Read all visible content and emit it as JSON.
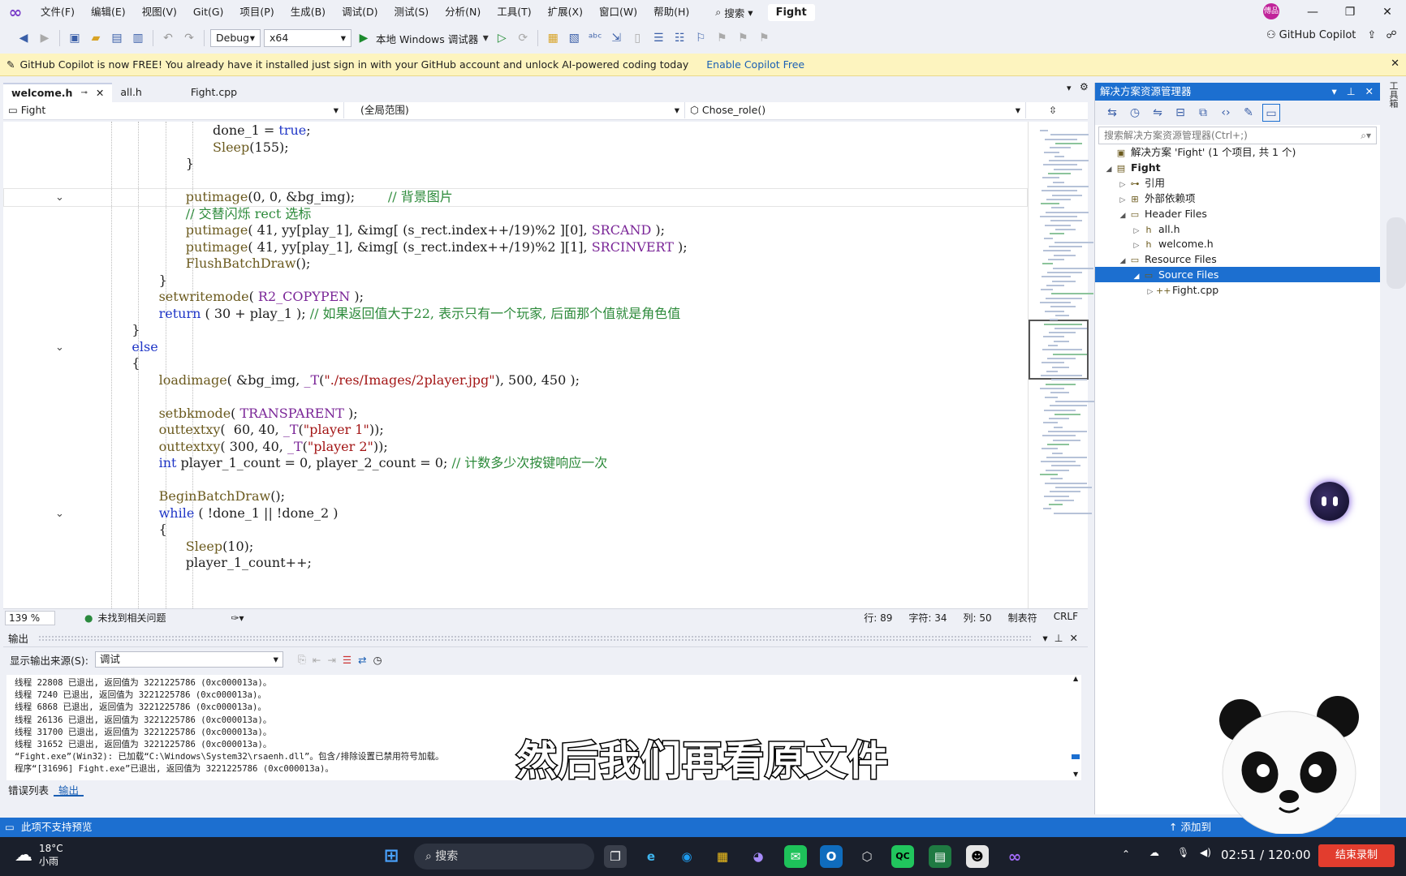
{
  "menu": [
    "文件(F)",
    "编辑(E)",
    "视图(V)",
    "Git(G)",
    "项目(P)",
    "生成(B)",
    "调试(D)",
    "测试(S)",
    "分析(N)",
    "工具(T)",
    "扩展(X)",
    "窗口(W)",
    "帮助(H)"
  ],
  "search_label": "搜索",
  "project_name": "Fight",
  "avatar_text": "傅品",
  "toolbar": {
    "config": "Debug",
    "platform": "x64",
    "run_label": "本地 Windows 调试器",
    "copilot_label": "GitHub Copilot"
  },
  "infobar": {
    "message": "GitHub Copilot is now FREE! You already have it installed just sign in with your GitHub account and unlock AI-powered coding today",
    "link": "Enable Copilot Free"
  },
  "tabs": [
    {
      "label": "welcome.h"
    },
    {
      "label": "all.h"
    },
    {
      "label": "Fight.cpp"
    }
  ],
  "navbar": {
    "project": "Fight",
    "scope": "(全局范围)",
    "member": "Chose_role()"
  },
  "code_lines": [
    {
      "indent": 10,
      "html": "done_1 = <span class=\"kw\">true</span>;"
    },
    {
      "indent": 10,
      "html": "<span class=\"fn\">Sleep</span>(155);"
    },
    {
      "indent": 8,
      "html": "}"
    },
    {
      "indent": 0,
      "html": ""
    },
    {
      "indent": 8,
      "fold": true,
      "current": true,
      "html": "<span class=\"fn\">putimage</span>(0, 0, &amp;bg_img);        <span class=\"cm\">// 背景图片</span>"
    },
    {
      "indent": 8,
      "html": "<span class=\"cm\">// 交替闪烁 rect 选标</span>"
    },
    {
      "indent": 8,
      "html": "<span class=\"fn\">putimage</span>( 41, yy[play_1], &amp;img[ (s_rect.index++/19)%2 ][0], <span class=\"mc\">SRCAND</span> );"
    },
    {
      "indent": 8,
      "html": "<span class=\"fn\">putimage</span>( 41, yy[play_1], &amp;img[ (s_rect.index++/19)%2 ][1], <span class=\"mc\">SRCINVERT</span> );"
    },
    {
      "indent": 8,
      "html": "<span class=\"fn\">FlushBatchDraw</span>();"
    },
    {
      "indent": 6,
      "html": "}"
    },
    {
      "indent": 6,
      "html": "<span class=\"fn\">setwritemode</span>( <span class=\"mc\">R2_COPYPEN</span> );"
    },
    {
      "indent": 6,
      "html": "<span class=\"kw\">return</span> ( 30 + play_1 ); <span class=\"cm\">// 如果返回值大于22, 表示只有一个玩家, 后面那个值就是角色值</span>"
    },
    {
      "indent": 4,
      "html": "}"
    },
    {
      "indent": 4,
      "fold": true,
      "html": "<span class=\"kw\">else</span>"
    },
    {
      "indent": 4,
      "html": "{"
    },
    {
      "indent": 6,
      "html": "<span class=\"fn\">loadimage</span>( &amp;bg_img, <span class=\"mc\">_T</span>(<span class=\"st\">\"./res/Images/2player.jpg\"</span>), 500, 450 );"
    },
    {
      "indent": 0,
      "html": ""
    },
    {
      "indent": 6,
      "html": "<span class=\"fn\">setbkmode</span>( <span class=\"mc\">TRANSPARENT</span> );"
    },
    {
      "indent": 6,
      "html": "<span class=\"fn\">outtextxy</span>(  60, 40, <span class=\"mc\">_T</span>(<span class=\"st\">\"player 1\"</span>));"
    },
    {
      "indent": 6,
      "html": "<span class=\"fn\">outtextxy</span>( 300, 40, <span class=\"mc\">_T</span>(<span class=\"st\">\"player 2\"</span>));"
    },
    {
      "indent": 6,
      "html": "<span class=\"kw\">int</span> player_1_count = 0, player_2_count = 0; <span class=\"cm\">// 计数多少次按键响应一次</span>"
    },
    {
      "indent": 0,
      "html": ""
    },
    {
      "indent": 6,
      "html": "<span class=\"fn\">BeginBatchDraw</span>();"
    },
    {
      "indent": 6,
      "fold": true,
      "html": "<span class=\"kw\">while</span> ( !done_1 || !done_2 )"
    },
    {
      "indent": 6,
      "html": "{"
    },
    {
      "indent": 8,
      "html": "<span class=\"fn\">Sleep</span>(10);"
    },
    {
      "indent": 8,
      "html": "player_1_count++;"
    }
  ],
  "editor_status": {
    "zoom": "139 %",
    "issues": "未找到相关问题",
    "line": "行: 89",
    "char": "字符: 34",
    "col": "列: 50",
    "tabs": "制表符",
    "eol": "CRLF"
  },
  "output": {
    "title": "输出",
    "source_label": "显示输出来源(S):",
    "source_value": "调试",
    "lines": [
      "线程 22808 已退出, 返回值为 3221225786 (0xc000013a)。",
      "线程 7240 已退出, 返回值为 3221225786 (0xc000013a)。",
      "线程 6868 已退出, 返回值为 3221225786 (0xc000013a)。",
      "线程 26136 已退出, 返回值为 3221225786 (0xc000013a)。",
      "线程 31700 已退出, 返回值为 3221225786 (0xc000013a)。",
      "线程 31652 已退出, 返回值为 3221225786 (0xc000013a)。",
      "“Fight.exe”(Win32): 已加载“C:\\Windows\\System32\\rsaenh.dll”。包含/排除设置已禁用符号加载。",
      "程序“[31696] Fight.exe”已退出, 返回值为 3221225786 (0xc000013a)。"
    ],
    "tabs": [
      "错误列表",
      "输出"
    ]
  },
  "solution": {
    "title": "解决方案资源管理器",
    "search_placeholder": "搜索解决方案资源管理器(Ctrl+;)",
    "items": [
      {
        "label": "解决方案 'Fight' (1 个项目, 共 1 个)",
        "level": 0,
        "arrow": "",
        "icon": "▣"
      },
      {
        "label": "Fight",
        "level": 0,
        "arrow": "◢",
        "icon": "▤",
        "bold": true
      },
      {
        "label": "引用",
        "level": 1,
        "arrow": "▷",
        "icon": "⊶"
      },
      {
        "label": "外部依赖项",
        "level": 1,
        "arrow": "▷",
        "icon": "⊞"
      },
      {
        "label": "Header Files",
        "level": 1,
        "arrow": "◢",
        "icon": "▭"
      },
      {
        "label": "all.h",
        "level": 2,
        "arrow": "▷",
        "icon": "h"
      },
      {
        "label": "welcome.h",
        "level": 2,
        "arrow": "▷",
        "icon": "h"
      },
      {
        "label": "Resource Files",
        "level": 1,
        "arrow": "◢",
        "icon": "▭"
      },
      {
        "label": "Source Files",
        "level": 2,
        "arrow": "◢",
        "icon": "▭",
        "selected": true
      },
      {
        "label": "Fight.cpp",
        "level": 3,
        "arrow": "▷",
        "icon": "++"
      }
    ]
  },
  "side_strip_label": "工具箱",
  "statusbar": {
    "message": "此项不支持预览",
    "right": "添加到"
  },
  "taskbar": {
    "temp": "18°C",
    "weather": "小雨",
    "search": "搜索",
    "clock": "02:51 / 120:00",
    "record": "结束录制"
  },
  "subtitle": "然后我们再看原文件"
}
